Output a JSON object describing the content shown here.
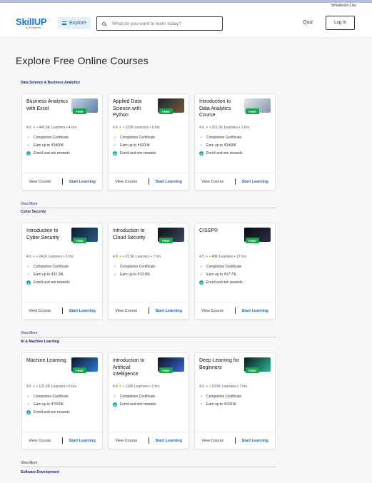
{
  "util_link": "Simplilearn Live",
  "header": {
    "logo_brand": "SkillUP",
    "logo_sub": "by Simplilearn",
    "explore": "Explore",
    "search_placeholder": "What do you want to learn today?",
    "quiz": "Quiz",
    "login": "Log In"
  },
  "page_title": "Explore Free Online Courses",
  "free_badge": "FREE",
  "footer": {
    "view_course": "View Course",
    "start_learning": "Start Learning"
  },
  "view_more": "View More",
  "sections": [
    {
      "title": "Data Science & Business Analytics",
      "courses": [
        {
          "title": "Business Analytics with Excel",
          "rating": "4.6",
          "learners": "445.5K Learners",
          "hours": "4 hrs",
          "features": [
            "Completion Certificate",
            "Earn up to ₹3406K",
            "Enroll and win rewards"
          ]
        },
        {
          "title": "Applied Data Science with Python",
          "rating": "4.5",
          "learners": "222K Learners",
          "hours": "6 hrs",
          "features": [
            "Completion Certificate",
            "Earn up to ₹4200K",
            "Enroll and win rewards"
          ]
        },
        {
          "title": "Introduction to Data Analytics Course",
          "rating": "4.6",
          "learners": "251.5K Learners",
          "hours": "3 hrs",
          "features": [
            "Completion Certificate",
            "Earn up to ₹3406K",
            "Enroll and win rewards"
          ]
        }
      ]
    },
    {
      "title": "Cyber Security",
      "courses": [
        {
          "title": "Introduction to Cyber Security",
          "rating": "4.6",
          "learners": "241K Learners",
          "hours": "3 hrs",
          "features": [
            "Completion Certificate",
            "Earn up to ₹32.28L",
            "Enroll and win rewards"
          ]
        },
        {
          "title": "Introduction to Cloud Security",
          "rating": "4.6",
          "learners": "21.5K Learners",
          "hours": "7 hrs",
          "features": [
            "Completion Certificate",
            "Earn up to ₹13.95L"
          ]
        },
        {
          "title": "CISSP®",
          "rating": "4.5",
          "learners": "49K Learners",
          "hours": "12 hrs",
          "features": [
            "Completion Certificate",
            "Earn up to ₹17.73L",
            "Enroll and win rewards"
          ]
        }
      ]
    },
    {
      "title": "AI & Machine Learning",
      "courses": [
        {
          "title": "Machine Learning",
          "rating": "4.5",
          "learners": "121.5K Learners",
          "hours": "6 hrs",
          "features": [
            "Completion Certificate",
            "Earn up to ₹7000K",
            "Enroll and win rewards"
          ]
        },
        {
          "title": "Introduction to Artificial Intelligence",
          "rating": "4.5",
          "learners": "110K Learners",
          "hours": "2 hrs",
          "features": [
            "Completion Certificate",
            "Enroll and win rewards"
          ]
        },
        {
          "title": "Deep Learning for Beginners",
          "rating": "4.6",
          "learners": "19.5K Learners",
          "hours": "7 hrs",
          "features": [
            "Completion Certificate",
            "Earn up to ₹1581K"
          ]
        }
      ]
    },
    {
      "title": "Software Development",
      "courses": []
    }
  ],
  "colors": {
    "accent": "#1a5fb4",
    "free_badge": "#19a34a",
    "star": "#f5a623"
  }
}
